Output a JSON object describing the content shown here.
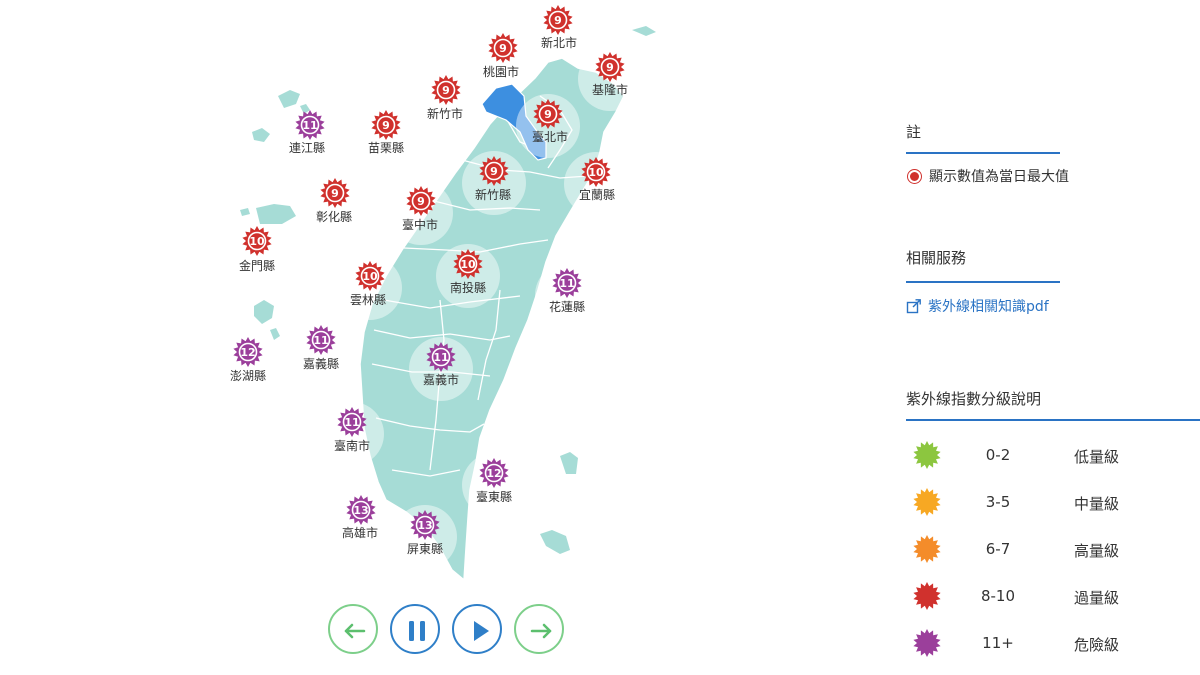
{
  "regions": [
    {
      "name": "新北市",
      "value": "9",
      "level": "excessive"
    },
    {
      "name": "桃園市",
      "value": "9",
      "level": "excessive"
    },
    {
      "name": "基隆市",
      "value": "9",
      "level": "excessive"
    },
    {
      "name": "新竹市",
      "value": "9",
      "level": "excessive"
    },
    {
      "name": "臺北市",
      "value": "9",
      "level": "excessive"
    },
    {
      "name": "連江縣",
      "value": "11",
      "level": "danger"
    },
    {
      "name": "苗栗縣",
      "value": "9",
      "level": "excessive"
    },
    {
      "name": "新竹縣",
      "value": "9",
      "level": "excessive"
    },
    {
      "name": "宜蘭縣",
      "value": "10",
      "level": "excessive"
    },
    {
      "name": "彰化縣",
      "value": "9",
      "level": "excessive"
    },
    {
      "name": "臺中市",
      "value": "9",
      "level": "excessive"
    },
    {
      "name": "金門縣",
      "value": "10",
      "level": "excessive"
    },
    {
      "name": "南投縣",
      "value": "10",
      "level": "excessive"
    },
    {
      "name": "雲林縣",
      "value": "10",
      "level": "excessive"
    },
    {
      "name": "花蓮縣",
      "value": "11",
      "level": "danger"
    },
    {
      "name": "嘉義縣",
      "value": "11",
      "level": "danger"
    },
    {
      "name": "澎湖縣",
      "value": "12",
      "level": "danger"
    },
    {
      "name": "嘉義市",
      "value": "11",
      "level": "danger"
    },
    {
      "name": "臺南市",
      "value": "11",
      "level": "danger"
    },
    {
      "name": "臺東縣",
      "value": "12",
      "level": "danger"
    },
    {
      "name": "高雄市",
      "value": "13",
      "level": "danger"
    },
    {
      "name": "屏東縣",
      "value": "13",
      "level": "danger"
    }
  ],
  "highlighted_region": "桃園市",
  "controls": {
    "prev": "left-arrow-icon",
    "pause": "pause-icon",
    "play": "play-icon",
    "next": "right-arrow-icon"
  },
  "sidebar": {
    "note_title": "註",
    "note_text": "顯示數值為當日最大值",
    "services_title": "相關服務",
    "services_link": "紫外線相關知識pdf",
    "legend_title": "紫外線指數分級說明",
    "legend": [
      {
        "range": "0-2",
        "label": "低量級",
        "color": "#8cc63f"
      },
      {
        "range": "3-5",
        "label": "中量級",
        "color": "#f7a823"
      },
      {
        "range": "6-7",
        "label": "高量級",
        "color": "#f48c2a"
      },
      {
        "range": "8-10",
        "label": "過量級",
        "color": "#d0312d"
      },
      {
        "range": "11+",
        "label": "危險級",
        "color": "#9b3f9b"
      }
    ]
  },
  "colors": {
    "land": "#a6dcd6",
    "border": "#ffffff",
    "highlight": "#3d8fe0",
    "accent": "#2a73c4",
    "excessive": "#d0312d",
    "danger": "#9b3f9b"
  }
}
